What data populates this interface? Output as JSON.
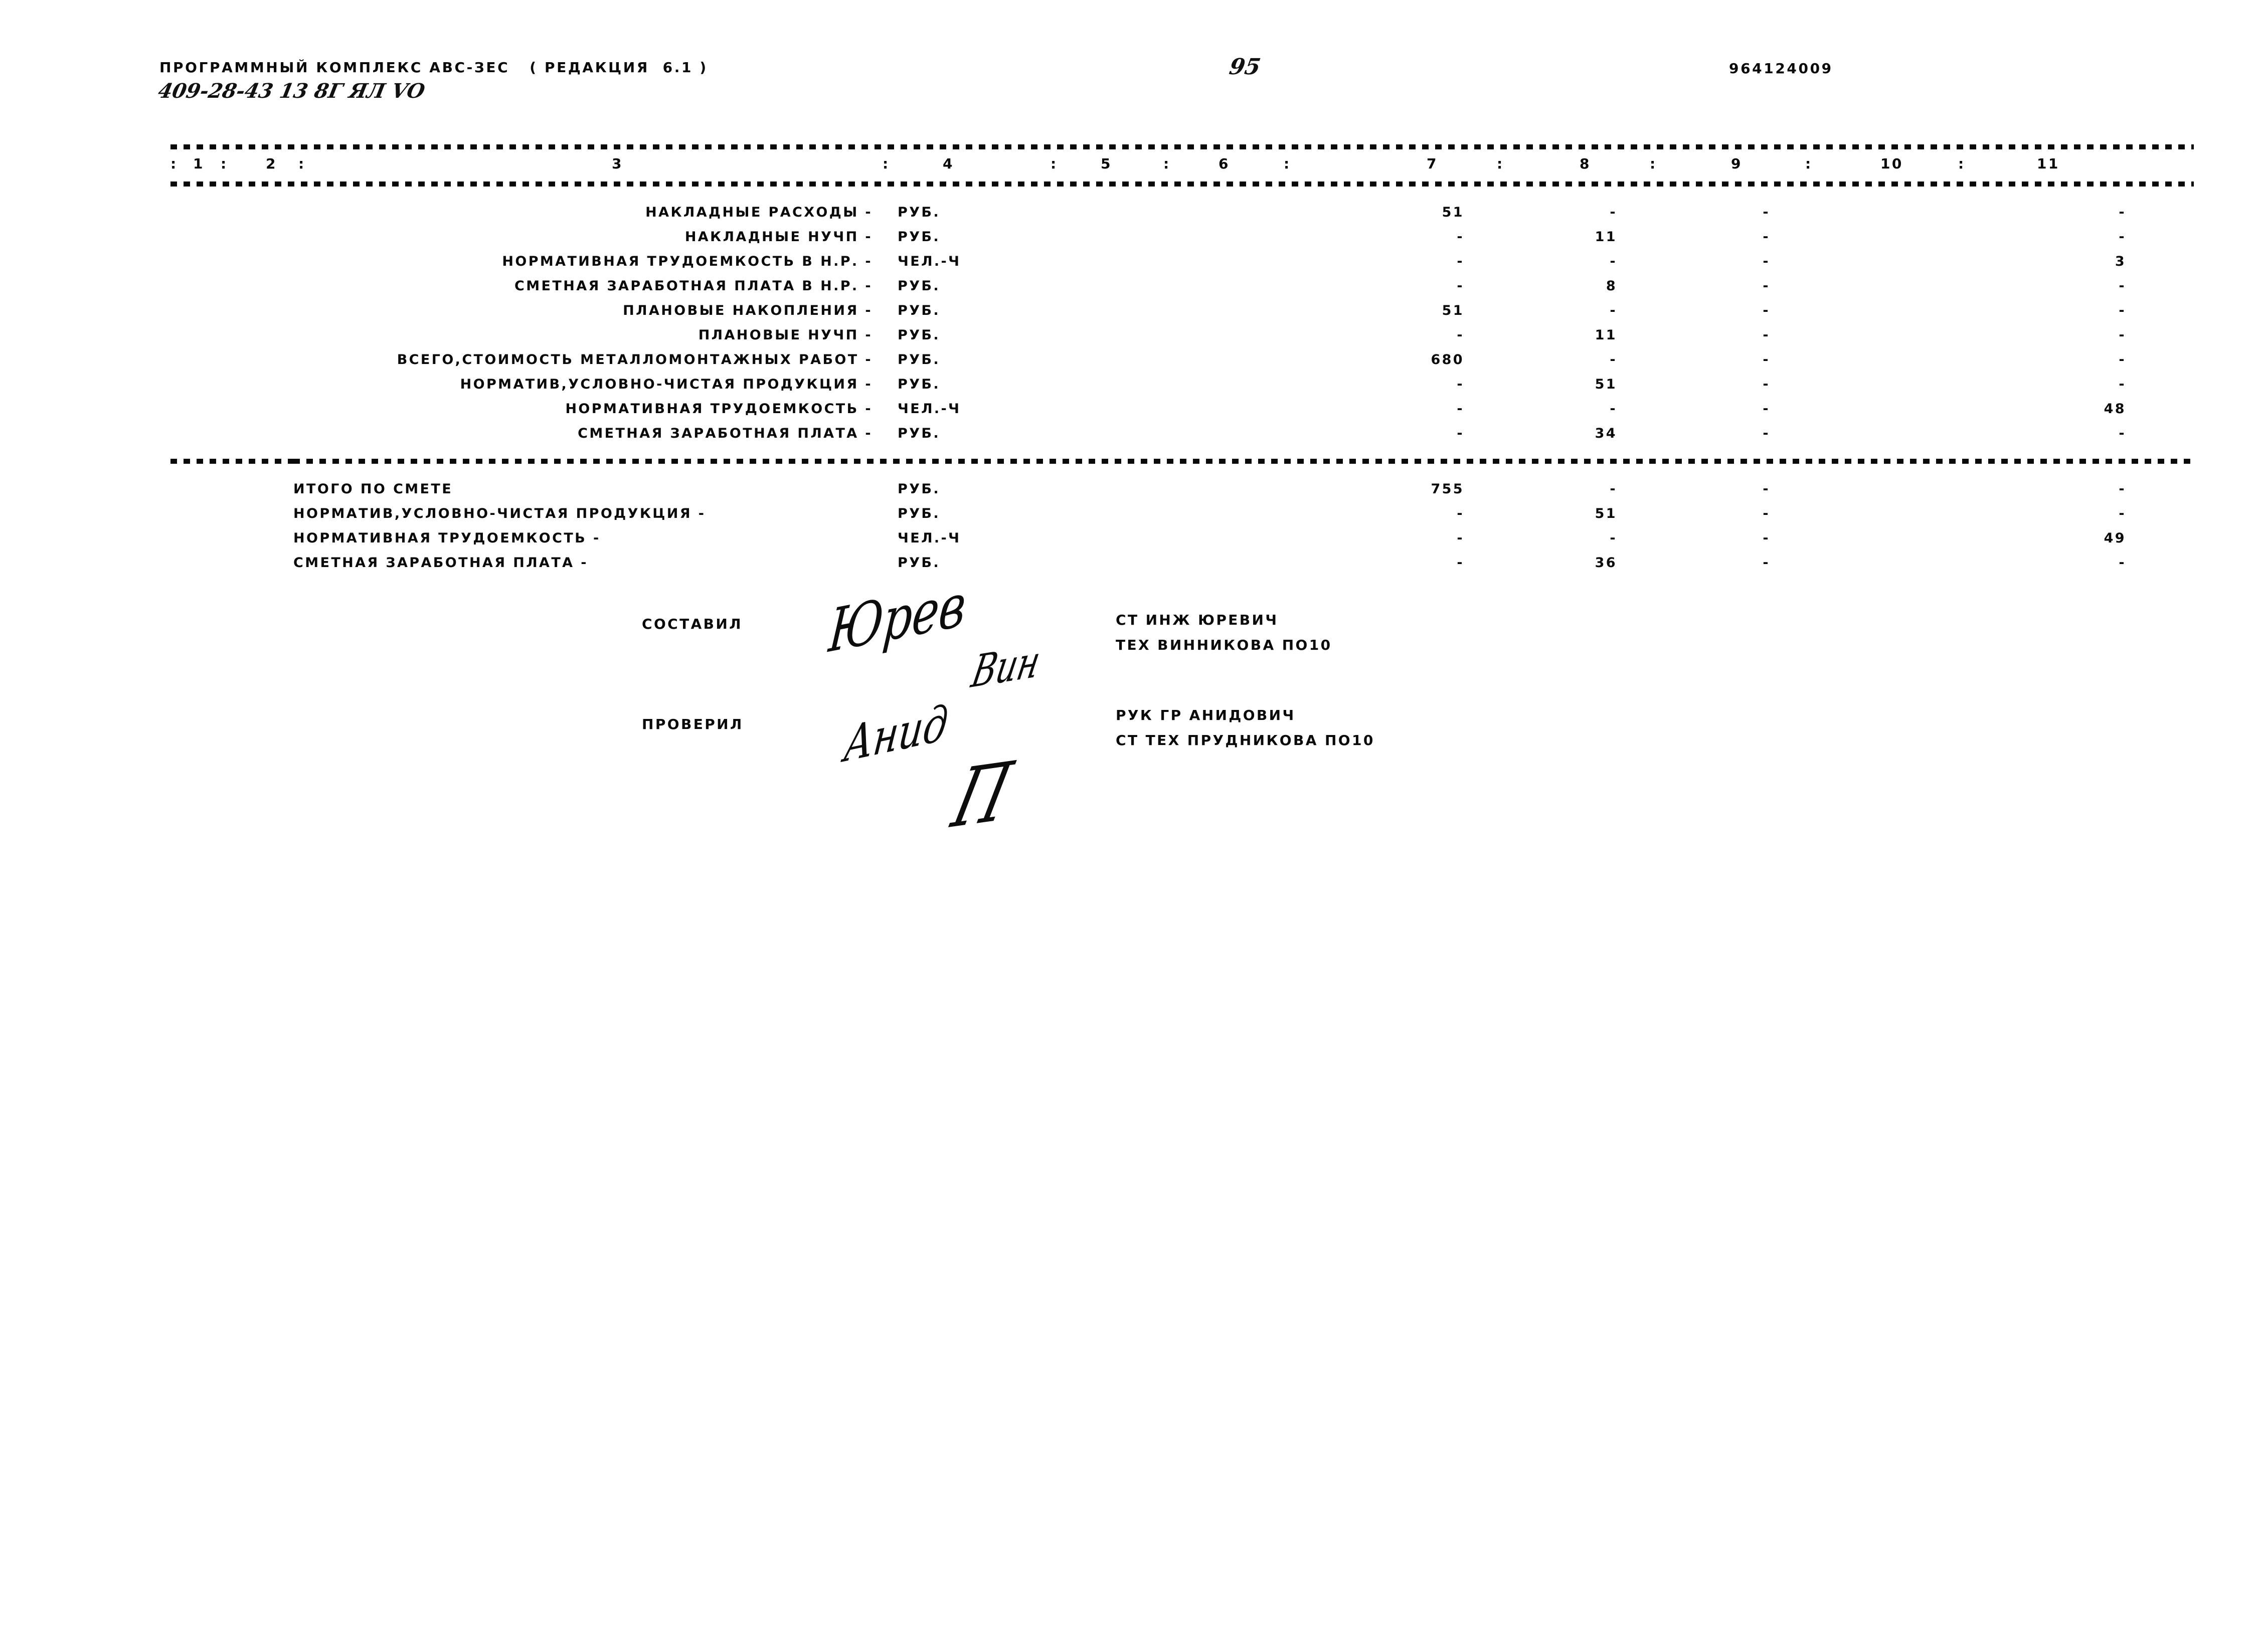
{
  "document": {
    "program_title": "ПРОГРАММНЫЙ КОМПЛЕКС АВС-ЗЕС   ( РЕДАКЦИЯ  6.1 )",
    "handwritten_code": "409-28-43 13 8Г ЯЛ VO",
    "page_number_handwritten": "95",
    "right_code": "964124009"
  },
  "table": {
    "column_numbers": [
      "1",
      "2",
      "3",
      "4",
      "5",
      "6",
      "7",
      "8",
      "9",
      "10",
      "11"
    ],
    "separator": ":",
    "empty_value": "-",
    "sections": [
      {
        "name": "metalwork-section",
        "rows": [
          {
            "label": "НАКЛАДНЫЕ РАСХОДЫ -",
            "unit": "РУБ.",
            "c7": "51",
            "c8": "-",
            "c9": "-",
            "c10": "",
            "c11": "-"
          },
          {
            "label": "НАКЛАДНЫЕ НУЧП -",
            "unit": "РУБ.",
            "c7": "-",
            "c8": "11",
            "c9": "-",
            "c10": "",
            "c11": "-"
          },
          {
            "label": "НОРМАТИВНАЯ ТРУДОЕМКОСТЬ В Н.Р. -",
            "unit": "ЧЕЛ.-Ч",
            "c7": "-",
            "c8": "-",
            "c9": "-",
            "c10": "",
            "c11": "3"
          },
          {
            "label": "СМЕТНАЯ ЗАРАБОТНАЯ ПЛАТА В Н.Р. -",
            "unit": "РУБ.",
            "c7": "-",
            "c8": "8",
            "c9": "-",
            "c10": "",
            "c11": "-"
          },
          {
            "label": "ПЛАНОВЫЕ НАКОПЛЕНИЯ -",
            "unit": "РУБ.",
            "c7": "51",
            "c8": "-",
            "c9": "-",
            "c10": "",
            "c11": "-"
          },
          {
            "label": "ПЛАНОВЫЕ НУЧП -",
            "unit": "РУБ.",
            "c7": "-",
            "c8": "11",
            "c9": "-",
            "c10": "",
            "c11": "-"
          },
          {
            "label": "ВСЕГО,СТОИМОСТЬ МЕТАЛЛОМОНТАЖНЫХ РАБОТ -",
            "unit": "РУБ.",
            "c7": "680",
            "c8": "-",
            "c9": "-",
            "c10": "",
            "c11": "-"
          },
          {
            "label": "НОРМАТИВ,УСЛОВНО-ЧИСТАЯ ПРОДУКЦИЯ -",
            "unit": "РУБ.",
            "c7": "-",
            "c8": "51",
            "c9": "-",
            "c10": "",
            "c11": "-"
          },
          {
            "label": "НОРМАТИВНАЯ ТРУДОЕМКОСТЬ -",
            "unit": "ЧЕЛ.-Ч",
            "c7": "-",
            "c8": "-",
            "c9": "-",
            "c10": "",
            "c11": "48"
          },
          {
            "label": "СМЕТНАЯ ЗАРАБОТНАЯ ПЛАТА -",
            "unit": "РУБ.",
            "c7": "-",
            "c8": "34",
            "c9": "-",
            "c10": "",
            "c11": "-"
          }
        ]
      },
      {
        "name": "totals-section",
        "rows": [
          {
            "label": "ИТОГО ПО СМЕТЕ",
            "unit": "РУБ.",
            "c7": "755",
            "c8": "-",
            "c9": "-",
            "c10": "",
            "c11": "-",
            "align": "left"
          },
          {
            "label": "НОРМАТИВ,УСЛОВНО-ЧИСТАЯ ПРОДУКЦИЯ -",
            "unit": "РУБ.",
            "c7": "-",
            "c8": "51",
            "c9": "-",
            "c10": "",
            "c11": "-",
            "align": "left"
          },
          {
            "label": "НОРМАТИВНАЯ ТРУДОЕМКОСТЬ -",
            "unit": "ЧЕЛ.-Ч",
            "c7": "-",
            "c8": "-",
            "c9": "-",
            "c10": "",
            "c11": "49",
            "align": "left"
          },
          {
            "label": "СМЕТНАЯ ЗАРАБОТНАЯ ПЛАТА -",
            "unit": "РУБ.",
            "c7": "-",
            "c8": "36",
            "c9": "-",
            "c10": "",
            "c11": "-",
            "align": "left"
          }
        ]
      }
    ]
  },
  "signatures": {
    "compiled": {
      "role": "СОСТАВИЛ",
      "name_line_1": "СТ ИНЖ ЮРЕВИЧ",
      "name_line_2": "ТЕХ ВИННИКОВА ПО10",
      "mark_1": "Юрев",
      "mark_2": "Вин"
    },
    "checked": {
      "role": "ПРОВЕРИЛ",
      "name_line_1": "РУК ГР АНИДОВИЧ",
      "name_line_2": "СТ ТЕХ ПРУДНИКОВА ПО10",
      "mark_1": "Анид",
      "mark_2": "П"
    }
  }
}
